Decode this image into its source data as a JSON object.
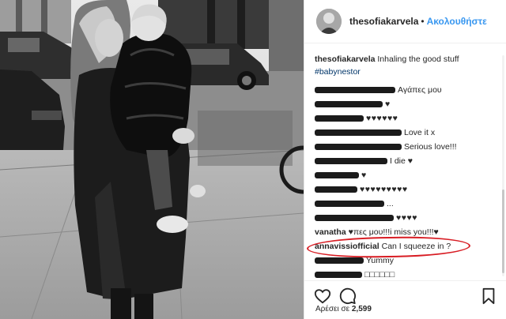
{
  "post": {
    "username": "thesofiakarvela",
    "separator": "•",
    "follow_label": "Ακολουθήστε"
  },
  "caption": {
    "username": "thesofiakarvela",
    "text": "Inhaling the good stuff",
    "hashtag": "#babynestor"
  },
  "comments": [
    {
      "text": "Αγάπες μου"
    },
    {
      "text": "♥"
    },
    {
      "text": "♥♥♥♥♥♥"
    },
    {
      "text": "Love it x"
    },
    {
      "text": "Serious love!!!"
    },
    {
      "text": "I die ♥"
    },
    {
      "text": "♥"
    },
    {
      "text": "♥♥♥♥♥♥♥♥♥"
    },
    {
      "text": "..."
    },
    {
      "text": "♥♥♥♥"
    },
    {
      "username": "vanatha",
      "text": "♥πες μου!!!i miss you!!!♥"
    },
    {
      "username": "annavissiofficial",
      "text": "Can I squeeze in ?"
    },
    {
      "text": "Yummy"
    },
    {
      "text": "□□□□□□"
    }
  ],
  "footer": {
    "likes_prefix": "Αρέσει σε",
    "likes_count": "2,599"
  },
  "icons": {
    "like": "heart-outline-icon",
    "comment": "speech-bubble-icon",
    "save": "bookmark-icon"
  },
  "colors": {
    "link": "#3897f0",
    "hashtag": "#003569",
    "highlight": "#d81d24"
  }
}
